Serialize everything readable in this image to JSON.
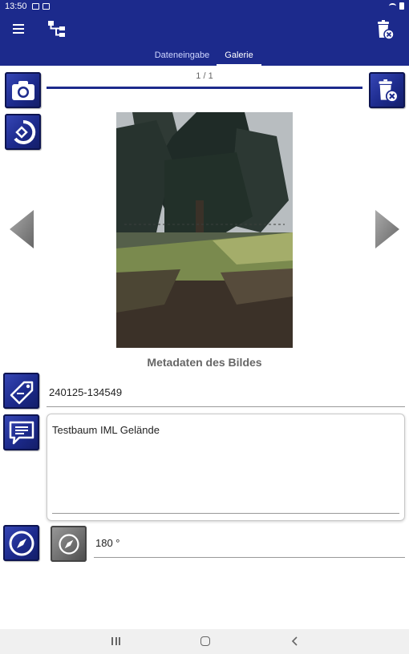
{
  "status_bar": {
    "time": "13:50"
  },
  "tabs": [
    {
      "label": "Dateneingabe",
      "active": false
    },
    {
      "label": "Galerie",
      "active": true
    }
  ],
  "gallery": {
    "counter": "1 / 1"
  },
  "metadata": {
    "title": "Metadaten des Bildes",
    "image_id": "240125-134549",
    "comment": "Testbaum IML Gelände",
    "direction": "180 °"
  },
  "colors": {
    "primary": "#1c2a8c",
    "background": "#ffffff"
  },
  "icons": [
    "menu-icon",
    "tree-structure-icon",
    "trash-icon",
    "camera-icon",
    "rotate-icon",
    "prev-arrow-icon",
    "next-arrow-icon",
    "tag-icon",
    "comment-icon",
    "compass-icon"
  ]
}
